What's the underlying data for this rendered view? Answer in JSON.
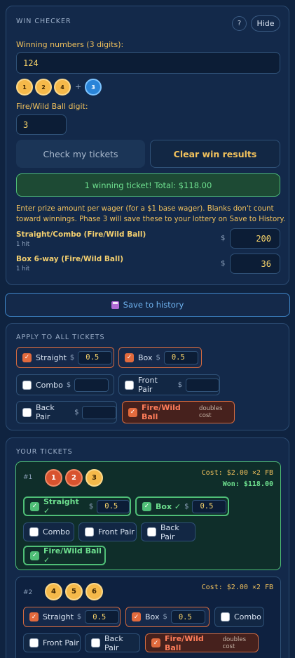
{
  "win_checker": {
    "title": "WIN CHECKER",
    "help_label": "?",
    "hide_label": "Hide",
    "winning_label": "Winning numbers (3 digits):",
    "winning_value": "124",
    "balls": [
      "1",
      "2",
      "4"
    ],
    "plus": "+",
    "fire_ball": "3",
    "fire_label": "Fire/Wild Ball digit:",
    "fire_value": "3",
    "check_button": "Check my tickets",
    "clear_button": "Clear win results",
    "result_banner": "1 winning ticket! Total: $118.00",
    "prize_note": "Enter prize amount per wager (for a $1 base wager). Blanks don't count toward winnings. Phase 3 will save these to your lottery on Save to History.",
    "prizes": [
      {
        "name": "Straight/Combo (Fire/Wild Ball)",
        "hits": "1 hit",
        "currency": "$",
        "value": "200"
      },
      {
        "name": "Box 6-way (Fire/Wild Ball)",
        "hits": "1 hit",
        "currency": "$",
        "value": "36"
      }
    ]
  },
  "save": {
    "icon": "floppy-disk-icon",
    "label": "Save to history"
  },
  "apply_all": {
    "title": "APPLY TO ALL TICKETS",
    "straight": "Straight",
    "straight_value": "0.5",
    "box": "Box",
    "box_value": "0.5",
    "combo": "Combo",
    "front_pair": "Front Pair",
    "back_pair": "Back Pair",
    "fire": "Fire/Wild Ball",
    "fire_note": "doubles cost",
    "currency": "$"
  },
  "tickets": {
    "title": "YOUR TICKETS",
    "ticket1": {
      "num": "#1",
      "balls": [
        "1",
        "2",
        "3"
      ],
      "cost": "Cost: $2.00 ×2 FB",
      "won": "Won: $118.00",
      "straight": "Straight ✓",
      "straight_value": "0.5",
      "box": "Box ✓",
      "box_value": "0.5",
      "combo": "Combo",
      "front_pair": "Front Pair",
      "back_pair": "Back Pair",
      "fire": "Fire/Wild Ball ✓"
    },
    "ticket2": {
      "num": "#2",
      "balls": [
        "4",
        "5",
        "6"
      ],
      "cost": "Cost: $2.00 ×2 FB",
      "straight": "Straight",
      "straight_value": "0.5",
      "box": "Box",
      "box_value": "0.5",
      "combo": "Combo",
      "front_pair": "Front Pair",
      "back_pair": "Back Pair",
      "fire": "Fire/Wild Ball",
      "fire_note": "doubles cost"
    },
    "currency": "$"
  },
  "colors": {
    "accent_orange": "#e26a3d",
    "win_green": "#4fbf77",
    "banner_bg": "#1d4a34",
    "gold": "#f1c15c"
  }
}
